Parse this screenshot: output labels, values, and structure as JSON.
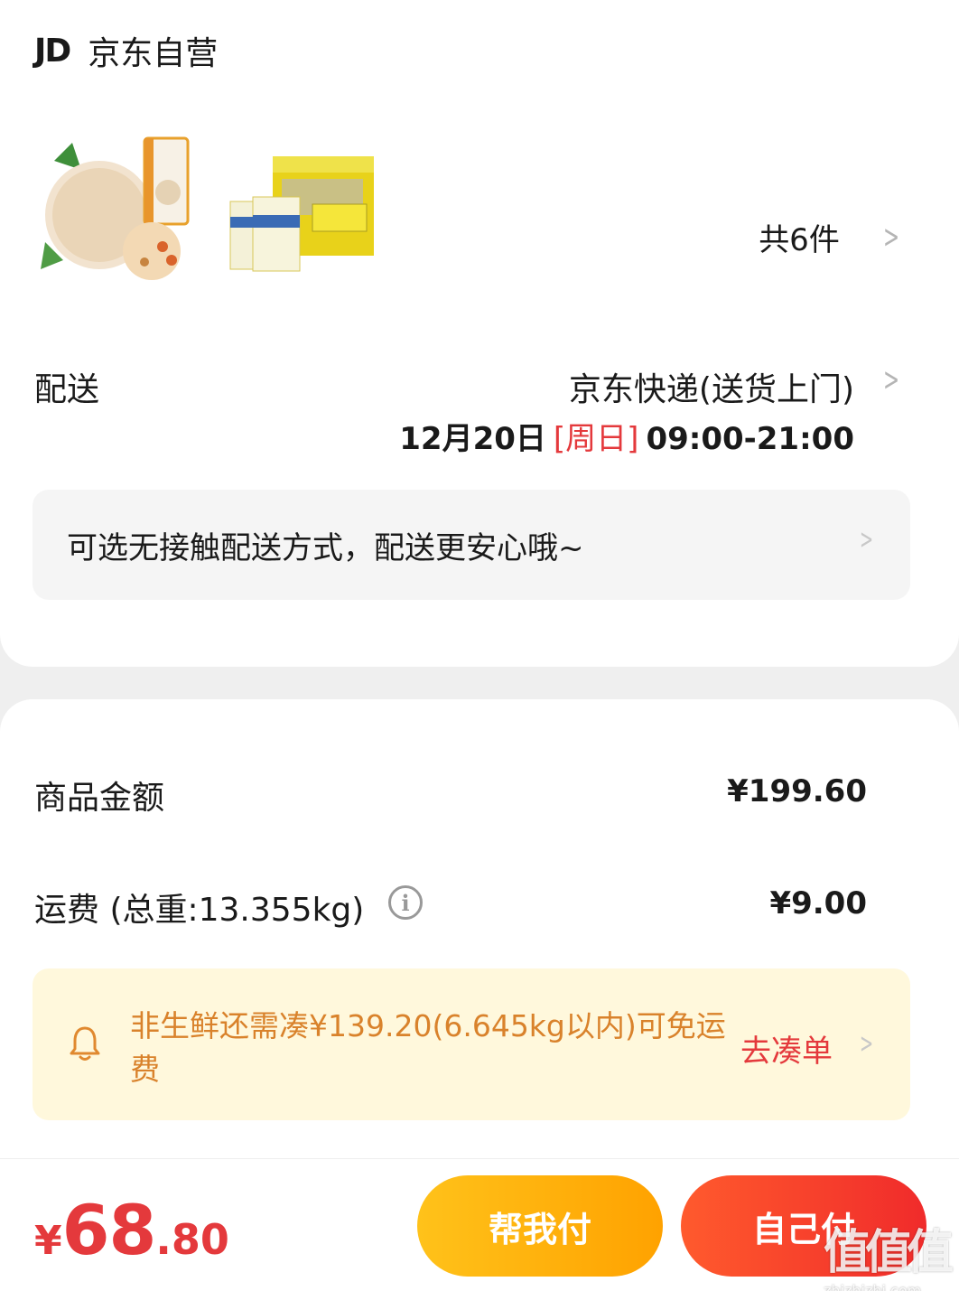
{
  "shop": {
    "logo": "JD",
    "name": "京东自营"
  },
  "products": {
    "items": [
      {
        "icon": "oat-product-image"
      },
      {
        "icon": "yogurt-box-image"
      }
    ],
    "count_label": "共6件"
  },
  "delivery": {
    "label": "配送",
    "method": "京东快递(送货上门)",
    "date": "12月20日",
    "weekday": "[周日]",
    "time_range": "09:00-21:00",
    "contactless_text": "可选无接触配送方式，配送更安心哦~"
  },
  "amounts": {
    "goods_label": "商品金额",
    "goods_value": "¥199.60",
    "shipping_label": "运费 (总重:13.355kg)",
    "shipping_value": "¥9.00"
  },
  "freeship": {
    "message": "非生鲜还需凑¥139.20(6.645kg以内)可免运费",
    "action": "去凑单"
  },
  "bottom": {
    "currency": "¥",
    "total_int": "68",
    "total_dec": ".80",
    "help_pay": "帮我付",
    "self_pay": "自己付"
  },
  "watermark": {
    "glyphs": "值值值",
    "url": "zhizhizhi.com"
  },
  "colors": {
    "accent_red": "#e4393c",
    "orange_text": "#d9822b",
    "yellow_button": "#ffb20d",
    "red_button": "#f53b2c"
  }
}
